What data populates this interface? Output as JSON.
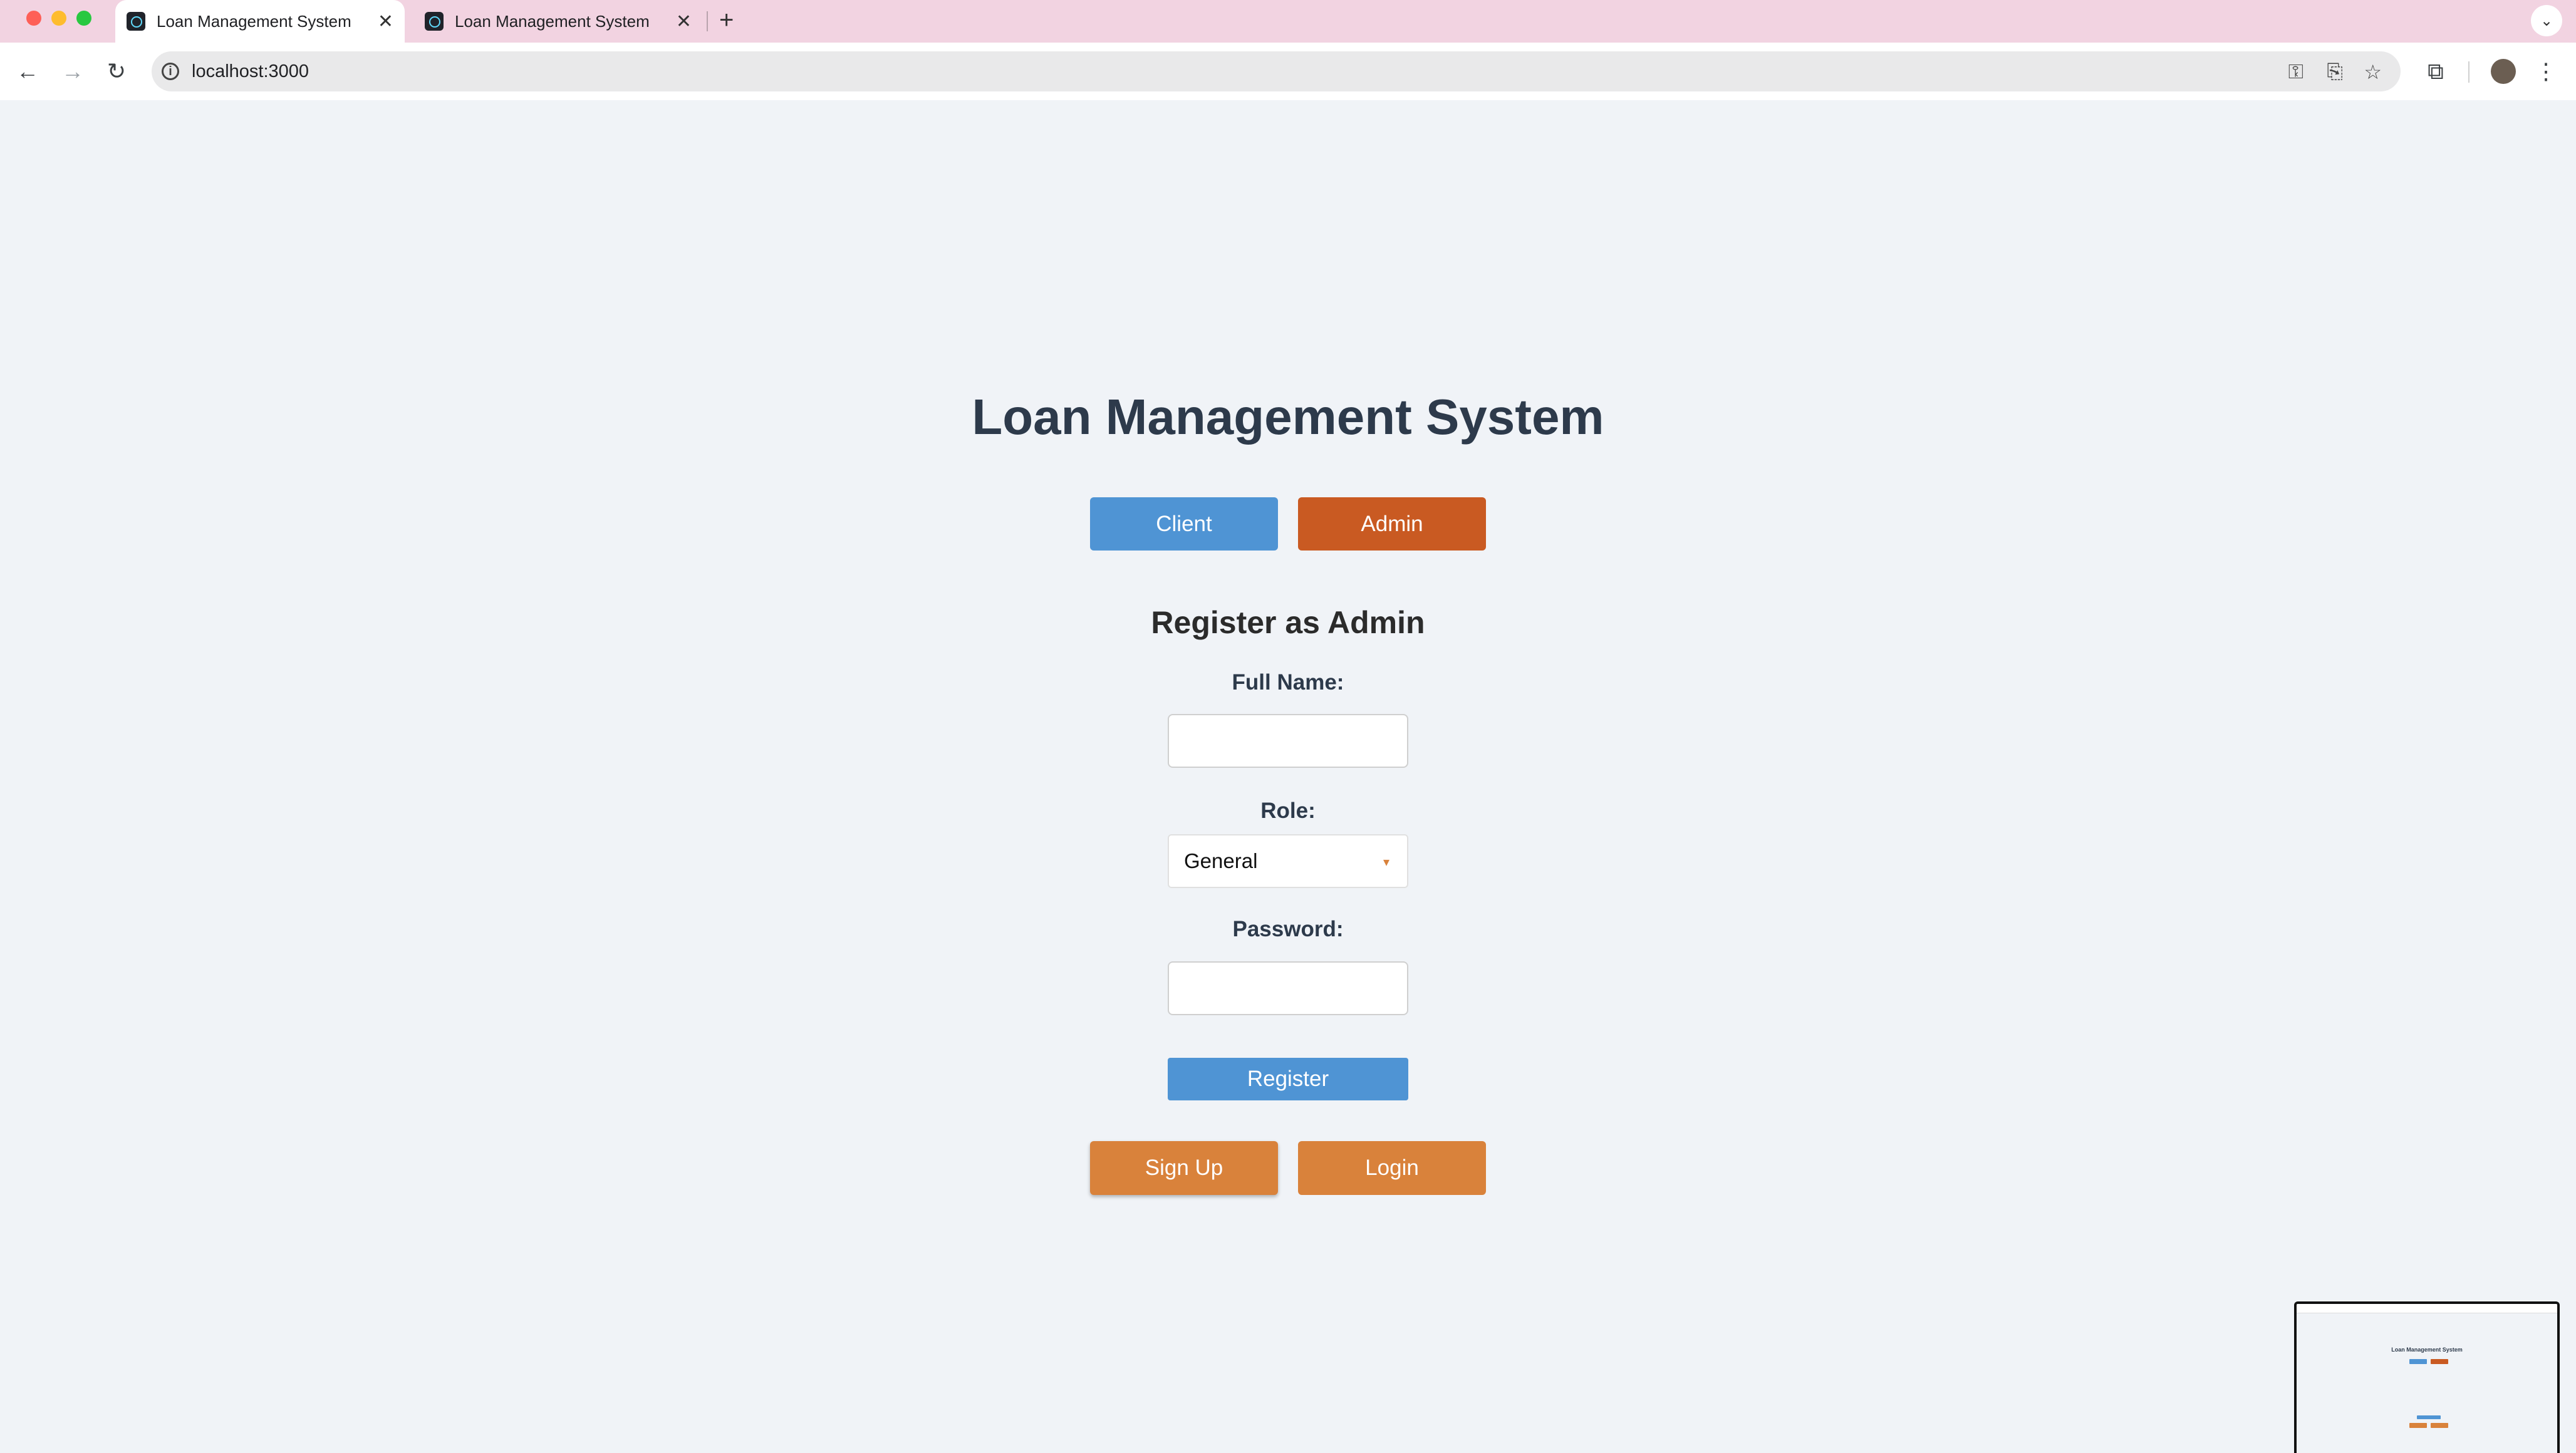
{
  "browser": {
    "tabs": [
      {
        "label": "Loan Management System",
        "active": true
      },
      {
        "label": "Loan Management System",
        "active": false
      }
    ],
    "new_tab_icon": "plus-icon",
    "url": "localhost:3000"
  },
  "page": {
    "title": "Loan Management System",
    "role_buttons": {
      "client": "Client",
      "admin": "Admin"
    },
    "form": {
      "title": "Register as Admin",
      "full_name_label": "Full Name:",
      "full_name_value": "",
      "role_label": "Role:",
      "role_value": "General",
      "password_label": "Password:",
      "password_value": "",
      "register_label": "Register"
    },
    "mode_buttons": {
      "signup": "Sign Up",
      "login": "Login"
    }
  },
  "colors": {
    "tabbar": "#f2d3e1",
    "page_bg": "#f0f3f7",
    "blue": "#4f94d4",
    "admin_orange": "#c95a22",
    "orange": "#d9823b",
    "heading": "#2d3a4b"
  }
}
